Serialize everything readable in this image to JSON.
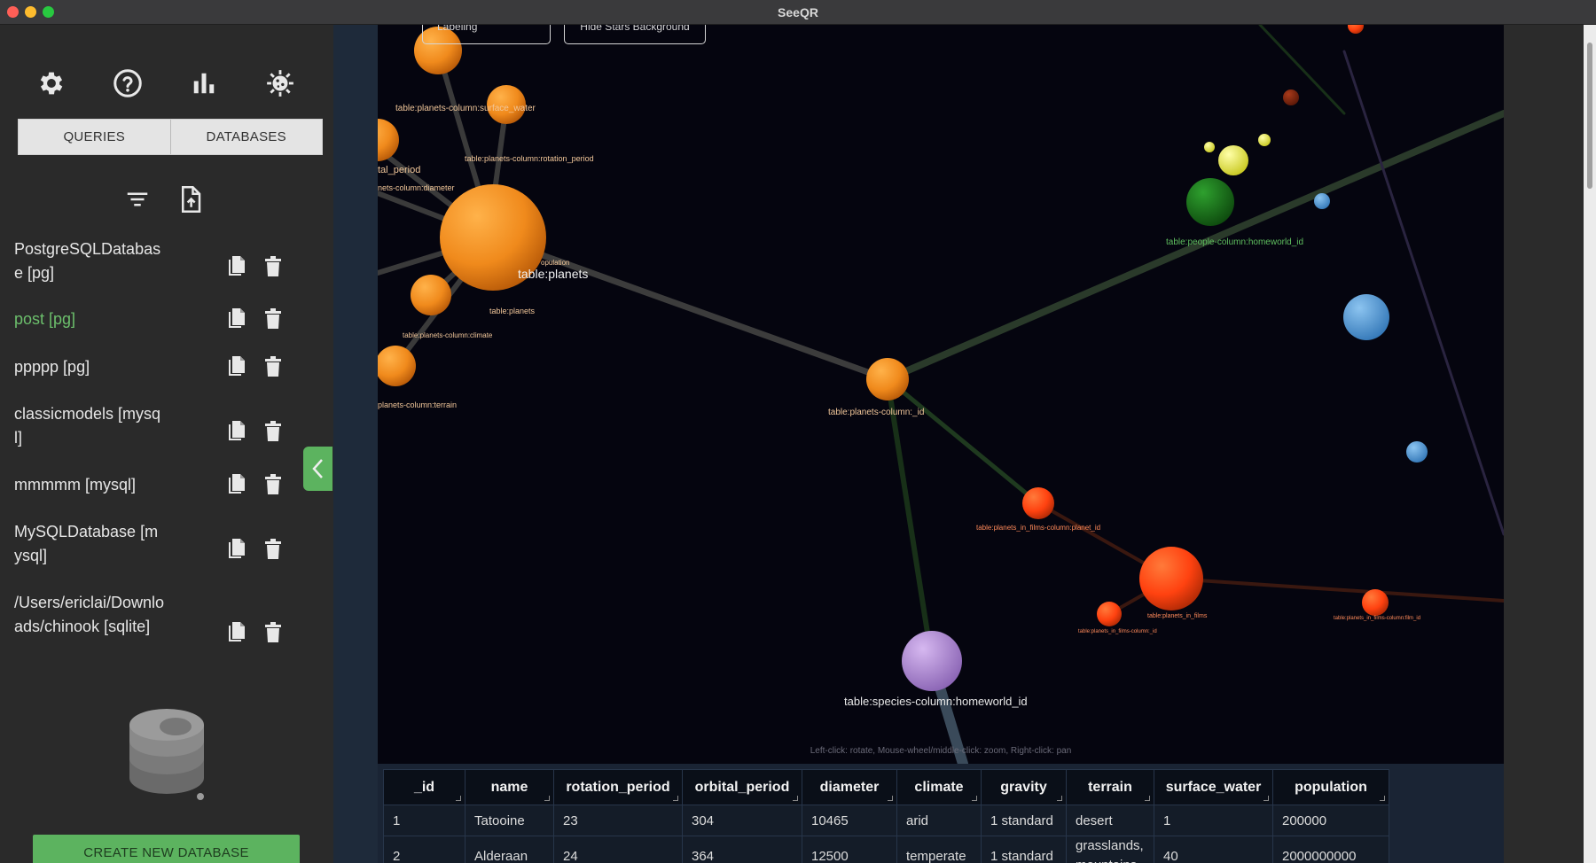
{
  "window": {
    "title": "SeeQR"
  },
  "sidebar": {
    "icons": [
      "gear-icon",
      "help-icon",
      "bar-chart-icon",
      "virus-icon"
    ],
    "tabs": [
      {
        "label": "QUERIES"
      },
      {
        "label": "DATABASES"
      }
    ],
    "tools": [
      "filter-icon",
      "file-upload-icon"
    ],
    "databases": [
      {
        "name": "PostgreSQLDatabase [pg]",
        "active": false
      },
      {
        "name": "post [pg]",
        "active": true
      },
      {
        "name": "ppppp [pg]",
        "active": false
      },
      {
        "name": "classicmodels [mysql]",
        "active": false
      },
      {
        "name": "mmmmm [mysql]",
        "active": false
      },
      {
        "name": "MySQLDatabase [mysql]",
        "active": false
      },
      {
        "name": "/Users/ericlai/Downloads/chinook [sqlite]",
        "active": false
      }
    ],
    "create_button": "CREATE NEW DATABASE"
  },
  "graph": {
    "buttons": [
      "Hide Nodes' Labeling",
      "Hide Stars Background"
    ],
    "hint": "Left-click: rotate, Mouse-wheel/middle-click: zoom, Right-click: pan",
    "labels": {
      "surface_water": "table:planets-column:surface_water",
      "rotation_period": "table:planets-column:rotation_period",
      "orbital_period": "tal_period",
      "diameter": "nets-column:diameter",
      "planets_big": "table:planets",
      "population": "opulation",
      "planets_small": "table:planets",
      "climate": "table:planets-column:climate",
      "terrain": "planets-column:terrain",
      "id": "table:planets-column:_id",
      "homeworld": "table:people-column:homeworld_id",
      "pif_planet": "table:planets_in_films-column:planet_id",
      "pif": "table:planets_in_films",
      "pif_id": "table:planets_in_films-column:_id",
      "pif_film": "table:planets_in_films-column:film_id",
      "species": "table:species-column:homeworld_id"
    },
    "colors": {
      "planets": "#f28a1e",
      "films": "#ff4a12",
      "people": "#1f7a1f",
      "species": "#b491d6",
      "blue": "#5a9fd8",
      "yellow": "#e8e838"
    }
  },
  "table": {
    "columns": [
      "_id",
      "name",
      "rotation_period",
      "orbital_period",
      "diameter",
      "climate",
      "gravity",
      "terrain",
      "surface_water",
      "population"
    ],
    "rows": [
      [
        "1",
        "Tatooine",
        "23",
        "304",
        "10465",
        "arid",
        "1 standard",
        "desert",
        "1",
        "200000"
      ],
      [
        "2",
        "Alderaan",
        "24",
        "364",
        "12500",
        "temperate",
        "1 standard",
        "grasslands, mountains",
        "40",
        "2000000000"
      ]
    ]
  }
}
